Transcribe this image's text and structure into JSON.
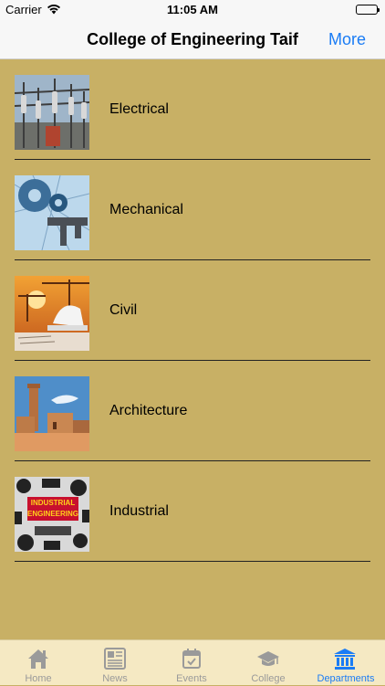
{
  "status_bar": {
    "carrier": "Carrier",
    "time": "11:05 AM"
  },
  "nav": {
    "title": "College of Engineering Taif",
    "more": "More"
  },
  "departments": [
    {
      "label": "Electrical"
    },
    {
      "label": "Mechanical"
    },
    {
      "label": "Civil"
    },
    {
      "label": "Architecture"
    },
    {
      "label": "Industrial",
      "image_text_1": "INDUSTRIAL",
      "image_text_2": "ENGINEERING"
    }
  ],
  "tabs": [
    {
      "label": "Home",
      "icon": "house-icon"
    },
    {
      "label": "News",
      "icon": "newspaper-icon"
    },
    {
      "label": "Events",
      "icon": "calendar-icon"
    },
    {
      "label": "College",
      "icon": "graduation-cap-icon"
    },
    {
      "label": "Departments",
      "icon": "institution-icon",
      "active": true
    }
  ],
  "colors": {
    "background": "#c8b065",
    "accent": "#1a7cf5",
    "tab_bar": "#f5e9c3"
  }
}
